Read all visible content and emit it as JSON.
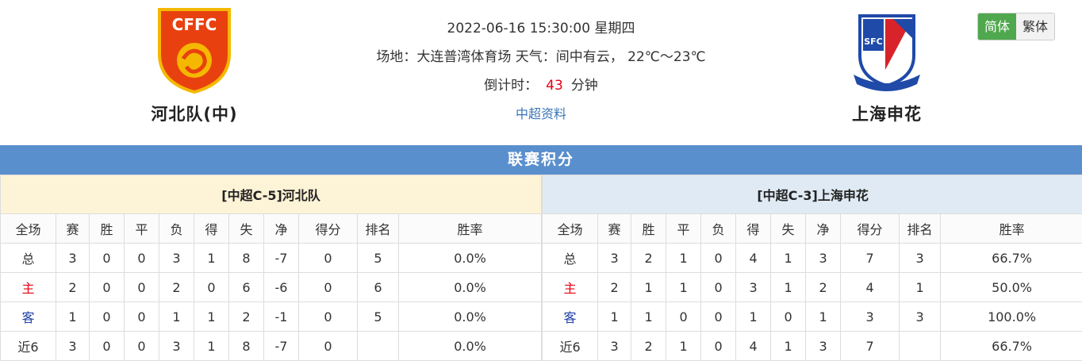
{
  "home_team": {
    "name": "河北队(中)",
    "logo_text": "CFFC"
  },
  "away_team": {
    "name": "上海申花",
    "logo_text": "SFC"
  },
  "match": {
    "datetime": "2022-06-16 15:30:00 星期四",
    "venue_line": "场地：大连普湾体育场 天气：间中有云， 22℃～23℃",
    "countdown_label": "倒计时：",
    "countdown_value": "43",
    "countdown_unit": "分钟",
    "info_link": "中超资料"
  },
  "lang": {
    "simplified": "简体",
    "traditional": "繁体"
  },
  "section_title": "联赛积分",
  "columns": [
    "全场",
    "赛",
    "胜",
    "平",
    "负",
    "得",
    "失",
    "净",
    "得分",
    "排名",
    "胜率"
  ],
  "home_table": {
    "caption": "[中超C-5]河北队",
    "rows": [
      {
        "label": "总",
        "cells": [
          "3",
          "0",
          "0",
          "3",
          "1",
          "8",
          "-7",
          "0",
          "5",
          "0.0%"
        ]
      },
      {
        "label": "主",
        "cells": [
          "2",
          "0",
          "0",
          "2",
          "0",
          "6",
          "-6",
          "0",
          "6",
          "0.0%"
        ]
      },
      {
        "label": "客",
        "cells": [
          "1",
          "0",
          "0",
          "1",
          "1",
          "2",
          "-1",
          "0",
          "5",
          "0.0%"
        ]
      },
      {
        "label": "近6",
        "cells": [
          "3",
          "0",
          "0",
          "3",
          "1",
          "8",
          "-7",
          "0",
          "",
          "0.0%"
        ]
      }
    ]
  },
  "away_table": {
    "caption": "[中超C-3]上海申花",
    "rows": [
      {
        "label": "总",
        "cells": [
          "3",
          "2",
          "1",
          "0",
          "4",
          "1",
          "3",
          "7",
          "3",
          "66.7%"
        ]
      },
      {
        "label": "主",
        "cells": [
          "2",
          "1",
          "1",
          "0",
          "3",
          "1",
          "2",
          "4",
          "1",
          "50.0%"
        ]
      },
      {
        "label": "客",
        "cells": [
          "1",
          "1",
          "0",
          "0",
          "1",
          "0",
          "1",
          "3",
          "3",
          "100.0%"
        ]
      },
      {
        "label": "近6",
        "cells": [
          "3",
          "2",
          "1",
          "0",
          "4",
          "1",
          "3",
          "7",
          "",
          "66.7%"
        ]
      }
    ]
  },
  "colors": {
    "accent_blue": "#5a8fcd",
    "red": "#e60012",
    "green": "#4fa84e"
  }
}
